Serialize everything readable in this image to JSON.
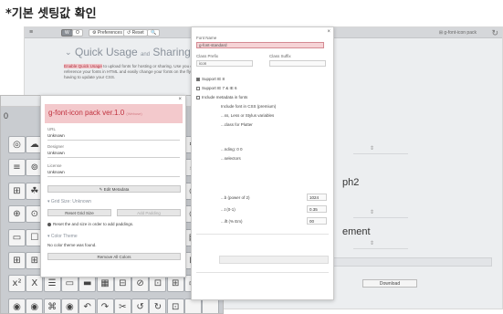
{
  "heading": "*기본 셋팅값 확인",
  "toolbar": {
    "menu_icon": "≡",
    "btn1": "W",
    "btn2": "O",
    "preferences": "⚙ Preferences",
    "reset": "↺ Reset",
    "search": "🔍",
    "right_label": "⊞ g-font-icon pack",
    "refresh_icon": "↻"
  },
  "quick": {
    "chevron": "⌄",
    "title_a": "Quick Usage",
    "title_and": "and",
    "title_b": "Sharing",
    "desc_hl": "Enable Quick Usage",
    "desc_rest": " to upload fonts for hosting or sharing. Use you can reference your fonts in HTML and easily change your fonts on the fly, without having to update your CSS."
  },
  "icon_panel": {
    "close": "×",
    "title": "g-font-icon pack ver.1.0",
    "title_sub": "(Webuse)",
    "url_label": "URL",
    "url_value": "Unknown",
    "designer_label": "Designer",
    "designer_value": "Unknown",
    "license_label": "License",
    "license_value": "Unknown",
    "edit_metadata": "✎ Edit Metadata",
    "grid_size_section": "▾ Grid Size: Unknown",
    "reset_grid_size": "Reset Grid Size",
    "add_padding": "Add Padding",
    "reset_hint": "Reset the and size in order to add paddings.",
    "color_section": "▾ Color Theme",
    "color_text": "No color theme was found.",
    "remove_colors": "Remove All Colors"
  },
  "settings_panel": {
    "close": "×",
    "font_name_label": "Font Name",
    "font_name_value": "g-font-standard",
    "class_prefix_label": "Class Prefix",
    "class_prefix_value": "icon",
    "class_suffix_label": "Class Suffix",
    "support_ie8": "Support IE 8",
    "support_ie7": "Support IE 7 & IE 6",
    "include_metadata": "Include metadata in fonts",
    "lines": [
      "Include font in CSS (premium)",
      "...ss, Less or Stylus variables",
      "...class for Plutter"
    ],
    "lines2": [
      "...nding: 0 0",
      "...selectors"
    ],
    "num_rows": [
      {
        "label": "...b (power of 2)",
        "value": "1024"
      },
      {
        "label": "...t (0-1)",
        "value": "0.35"
      },
      {
        "label": "...ift (% Em)",
        "value": "00"
      }
    ]
  },
  "background": {
    "big1": "ph2",
    "big2": "ement",
    "download": "Download",
    "arrow": "⇕"
  },
  "grid": {
    "close": "0",
    "rows": [
      [
        "◎",
        "☁",
        "✿",
        "",
        "",
        "",
        "",
        "",
        "",
        "",
        "⚙",
        "⋯"
      ],
      [
        "≡",
        "⊚",
        "",
        "",
        "",
        "",
        "",
        "",
        "",
        "",
        "☕",
        "⚙"
      ],
      [
        "⊞",
        "☘",
        "",
        "",
        "",
        "",
        "",
        "",
        "",
        "",
        "◷",
        "◷"
      ],
      [
        "⊕",
        "⊙",
        "",
        "",
        "",
        "",
        "",
        "",
        "",
        "",
        "◷",
        "▽"
      ],
      [
        "▭",
        "☐",
        "",
        "",
        "",
        "",
        "",
        "",
        "",
        "",
        "▤",
        "☰"
      ],
      [
        "⊞",
        "⊞",
        "",
        "",
        "",
        "",
        "",
        "",
        "",
        "",
        "⊞",
        "⋁"
      ],
      [
        "x²",
        "X",
        "☰",
        "▭",
        "▬",
        "▦",
        "⊟",
        "⊘",
        "⊡",
        "⊞",
        "▭",
        "≣"
      ],
      [
        "◉",
        "◉",
        "⌘",
        "◉",
        "↶",
        "↷",
        "✂",
        "↺",
        "↻",
        "⊡",
        "",
        ""
      ]
    ]
  }
}
